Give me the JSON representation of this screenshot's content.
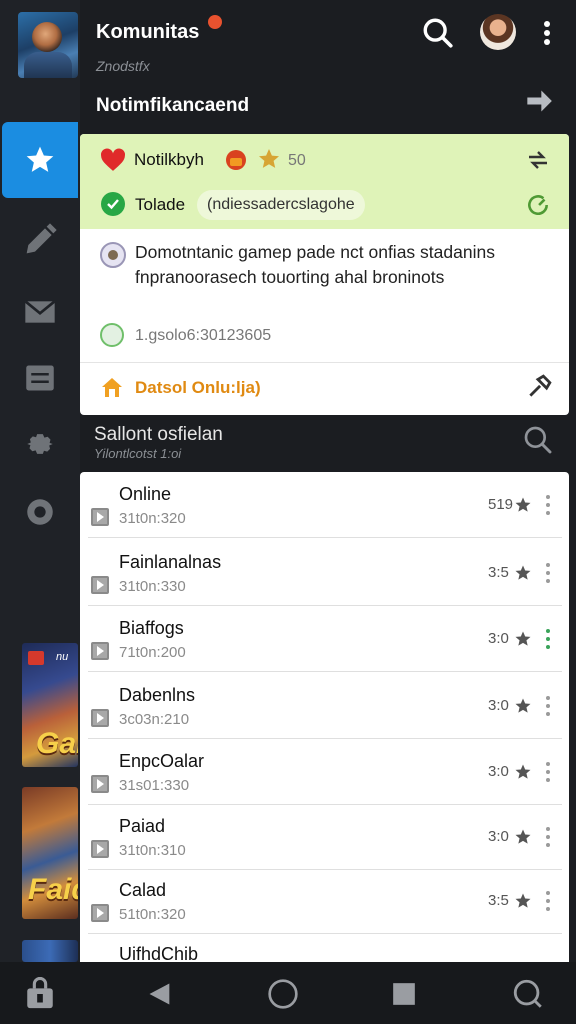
{
  "header": {
    "title": "Komunitas",
    "subtitle": "Znodstfx",
    "section_heading": "Notimfikancaend"
  },
  "notifications": [
    {
      "text": "Notilkbyh",
      "count": "50",
      "icon": "heart-icon"
    },
    {
      "title": "Tolade",
      "pill": "(ndiessadercslagohe",
      "icon": "check-icon"
    },
    {
      "text": "Domotntanic gamep pade nct onfias stadanins fnpranoorasech touorting ahal broninots",
      "meta": "1.gsolo6:30123605"
    },
    {
      "text": "Datsol Onlu:lja)",
      "icon": "home-icon"
    }
  ],
  "online": {
    "title": "Sallont osfielan",
    "subtitle": "Yilontlcotst 1:oi"
  },
  "players": [
    {
      "name": "Online",
      "meta": "31t0n:320",
      "rating": "519"
    },
    {
      "name": "Fainlanalnas",
      "meta": "31t0n:330",
      "rating": "3:5"
    },
    {
      "name": "Biaffogs",
      "meta": "71t0n:200",
      "rating": "3:0"
    },
    {
      "name": "Dabenlns",
      "meta": "3c03n:210",
      "rating": "3:0"
    },
    {
      "name": "EnpcOalar",
      "meta": "31s01:330",
      "rating": "3:0"
    },
    {
      "name": "Paiad",
      "meta": "31t0n:310",
      "rating": "3:0"
    },
    {
      "name": "Calad",
      "meta": "51t0n:320",
      "rating": "3:5"
    },
    {
      "name": "UifhdChib",
      "meta": "",
      "rating": ""
    }
  ],
  "thumbs": {
    "first": "Gai",
    "second": "Faid",
    "first_tag": "nu"
  },
  "colors": {
    "accent": "#1b8de1",
    "notif_bg": "#dff3b8",
    "warning": "#e08a12",
    "success": "#28a745"
  }
}
